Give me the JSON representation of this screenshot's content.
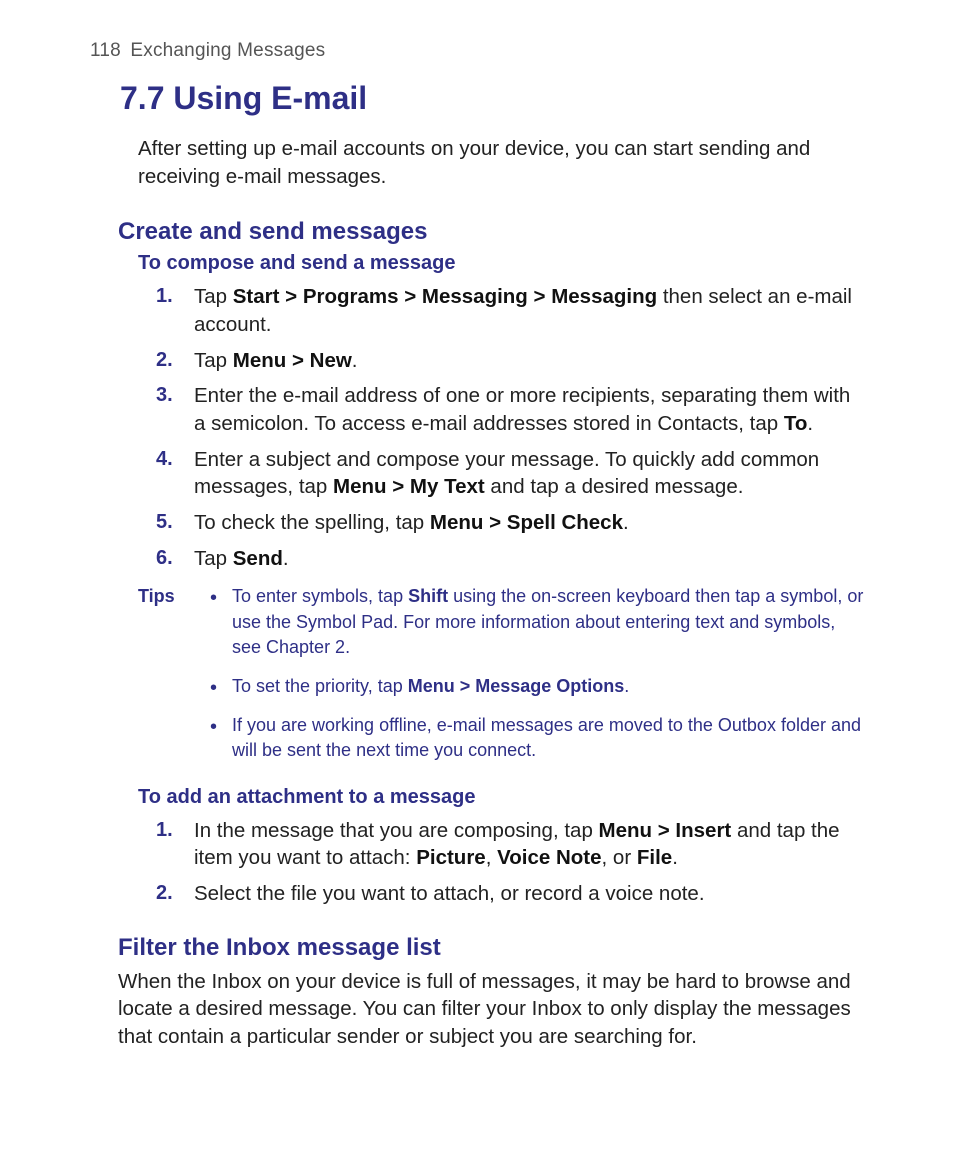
{
  "header": {
    "page_number": "118",
    "chapter_title": "Exchanging Messages"
  },
  "h1": "7.7 Using E-mail",
  "intro": "After setting up e-mail accounts on your device, you can start sending and receiving e-mail messages.",
  "section1": {
    "title": "Create and send messages",
    "subA": {
      "title": "To compose and send a message",
      "steps": {
        "s1_a": "Tap ",
        "s1_b": "Start > Programs > Messaging > Messaging",
        "s1_c": " then select an e-mail account.",
        "s2_a": "Tap ",
        "s2_b": "Menu > New",
        "s2_c": ".",
        "s3_a": "Enter the e-mail address of one or more recipients, separating them with a semicolon. To access e-mail addresses stored in Contacts, tap ",
        "s3_b": "To",
        "s3_c": ".",
        "s4_a": "Enter a subject and compose your message. To quickly add common messages, tap ",
        "s4_b": "Menu > My Text",
        "s4_c": " and tap a desired message.",
        "s5_a": "To check the spelling, tap ",
        "s5_b": "Menu > Spell Check",
        "s5_c": ".",
        "s6_a": "Tap ",
        "s6_b": "Send",
        "s6_c": "."
      }
    },
    "tips_label": "Tips",
    "tips": {
      "t1_a": "To enter symbols, tap ",
      "t1_b": "Shift",
      "t1_c": " using the on-screen keyboard then tap a symbol, or use the Symbol Pad. For more information about entering text and symbols, see Chapter 2.",
      "t2_a": "To set the priority, tap ",
      "t2_b": "Menu > Message Options",
      "t2_c": ".",
      "t3": "If you are working offline, e-mail messages are moved to the Outbox folder and will be sent the next time you connect."
    },
    "subB": {
      "title": "To add an attachment to a message",
      "steps": {
        "s1_a": "In the message that you are composing, tap ",
        "s1_b": "Menu > Insert",
        "s1_c": " and tap the item you want to attach: ",
        "s1_d": "Picture",
        "s1_e": ", ",
        "s1_f": "Voice Note",
        "s1_g": ", or ",
        "s1_h": "File",
        "s1_i": ".",
        "s2": "Select the file you want to attach, or record a voice note."
      }
    }
  },
  "section2": {
    "title": "Filter the Inbox message list",
    "para": "When the Inbox on your device is full of messages, it may be hard to browse and locate a desired message. You can filter your Inbox to only display the messages that contain a particular sender or subject you are searching for."
  },
  "numbers": {
    "n1": "1.",
    "n2": "2.",
    "n3": "3.",
    "n4": "4.",
    "n5": "5.",
    "n6": "6."
  }
}
